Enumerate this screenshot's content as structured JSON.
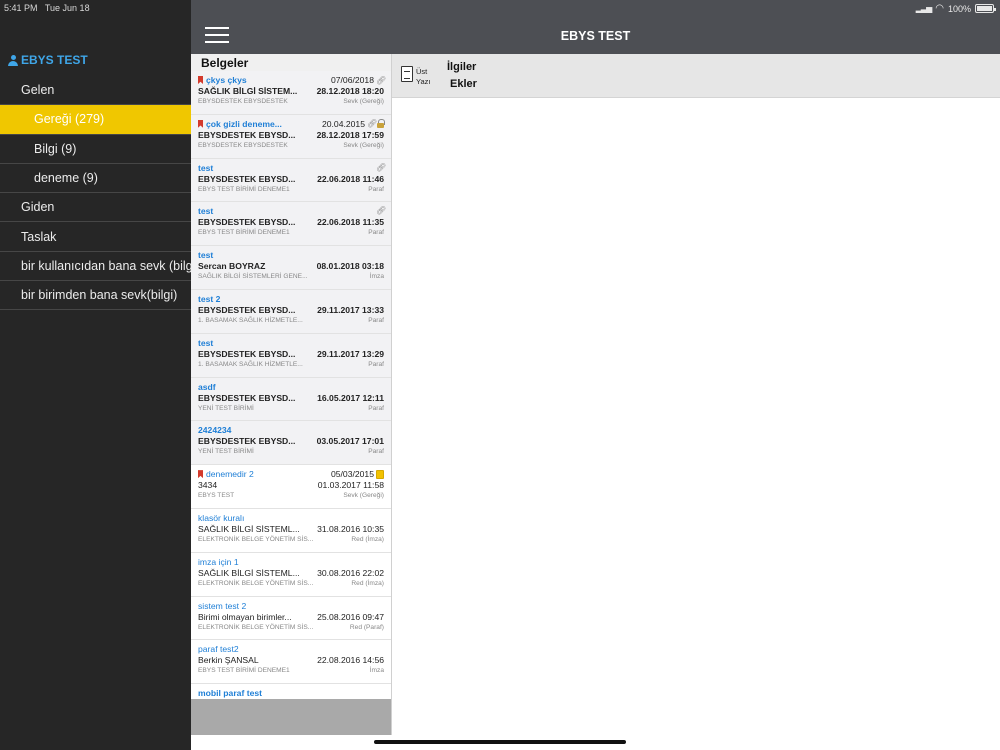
{
  "status": {
    "time": "5:41 PM",
    "date": "Tue Jun 18",
    "battery": "100%",
    "wifi_icon": "wifi-icon",
    "signal_icon": "signal-icon"
  },
  "header": {
    "title": "EBYS TEST",
    "menu_icon": "hamburger-icon"
  },
  "sidebar": {
    "account": "EBYS TEST",
    "items": [
      {
        "label": "Gelen",
        "level": 1,
        "active": false
      },
      {
        "label": "Gereği (279)",
        "level": 2,
        "active": true
      },
      {
        "label": "Bilgi (9)",
        "level": 2,
        "active": false
      },
      {
        "label": "deneme (9)",
        "level": 2,
        "active": false
      },
      {
        "label": "Giden",
        "level": 1,
        "active": false
      },
      {
        "label": "Taslak",
        "level": 1,
        "active": false
      },
      {
        "label": "bir kullanıcıdan bana sevk (bilgi)",
        "level": 1,
        "active": false
      },
      {
        "label": "bir birimden bana sevk(bilgi)",
        "level": 1,
        "active": false
      }
    ],
    "accent_color": "#f0c700"
  },
  "list": {
    "title": "Belgeler",
    "rows": [
      {
        "subject": "çkys çkys",
        "sender": "SAĞLIK BİLGİ SİSTEM...",
        "unit": "EBYSDESTEK EBYSDESTEK",
        "date1": "07/06/2018",
        "date2": "28.12.2018 18:20",
        "action": "Sevk (Gereği)"
      },
      {
        "subject": "çok gizli deneme...",
        "sender": "EBYSDESTEK EBYSD...",
        "unit": "EBYSDESTEK EBYSDESTEK",
        "date1": "20.04.2015",
        "date2": "28.12.2018 17:59",
        "action": "Sevk (Gereği)"
      },
      {
        "subject": "test",
        "sender": "EBYSDESTEK EBYSD...",
        "unit": "EBYS TEST BİRİMİ DENEME1",
        "date1": "",
        "date2": "22.06.2018 11:46",
        "action": "Paraf"
      },
      {
        "subject": "test",
        "sender": "EBYSDESTEK EBYSD...",
        "unit": "EBYS TEST BİRİMİ DENEME1",
        "date1": "",
        "date2": "22.06.2018 11:35",
        "action": "Paraf"
      },
      {
        "subject": "test",
        "sender": "Sercan BOYRAZ",
        "unit": "SAĞLIK BİLGİ SİSTEMLERİ GENE...",
        "date1": "",
        "date2": "08.01.2018 03:18",
        "action": "İmza"
      },
      {
        "subject": "test 2",
        "sender": "EBYSDESTEK EBYSD...",
        "unit": "1. BASAMAK SAĞLIK HİZMETLE...",
        "date1": "",
        "date2": "29.11.2017 13:33",
        "action": "Paraf"
      },
      {
        "subject": "test",
        "sender": "EBYSDESTEK EBYSD...",
        "unit": "1. BASAMAK SAĞLIK HİZMETLE...",
        "date1": "",
        "date2": "29.11.2017 13:29",
        "action": "Paraf"
      },
      {
        "subject": "asdf",
        "sender": "EBYSDESTEK EBYSD...",
        "unit": "YENİ TEST BİRİMİ",
        "date1": "",
        "date2": "16.05.2017 12:11",
        "action": "Paraf"
      },
      {
        "subject": "2424234",
        "sender": "EBYSDESTEK EBYSD...",
        "unit": "YENİ TEST BİRİMİ",
        "date1": "",
        "date2": "03.05.2017 17:01",
        "action": "Paraf"
      },
      {
        "subject": "denemedir 2",
        "sender": "3434",
        "unit": "EBYS TEST",
        "date1": "05/03/2015",
        "date2": "01.03.2017 11:58",
        "action": "Sevk (Gereği)"
      },
      {
        "subject": "klasör kuralı",
        "sender": "SAĞLIK BİLGİ SİSTEML...",
        "unit": "ELEKTRONİK BELGE YÖNETİM SİS...",
        "date1": "",
        "date2": "31.08.2016 10:35",
        "action": "Red (İmza)"
      },
      {
        "subject": "imza için 1",
        "sender": "SAĞLIK BİLGİ SİSTEML...",
        "unit": "ELEKTRONİK BELGE YÖNETİM SİS...",
        "date1": "",
        "date2": "30.08.2016 22:02",
        "action": "Red (İmza)"
      },
      {
        "subject": "sistem test 2",
        "sender": "Birimi olmayan birimler...",
        "unit": "ELEKTRONİK BELGE YÖNETİM SİS...",
        "date1": "",
        "date2": "25.08.2016 09:47",
        "action": "Red (Paraf)"
      },
      {
        "subject": "paraf test2",
        "sender": "Berkin ŞANSAL",
        "unit": "EBYS TEST BİRİMİ DENEME1",
        "date1": "",
        "date2": "22.08.2016 14:56",
        "action": "İmza"
      },
      {
        "subject": "mobil paraf test",
        "sender": "",
        "unit": "",
        "date1": "",
        "date2": "",
        "action": ""
      }
    ]
  },
  "detail": {
    "doc_button_label": "Üst Yazı",
    "tab_related": "İlgiler",
    "tab_attachments": "Ekler"
  }
}
